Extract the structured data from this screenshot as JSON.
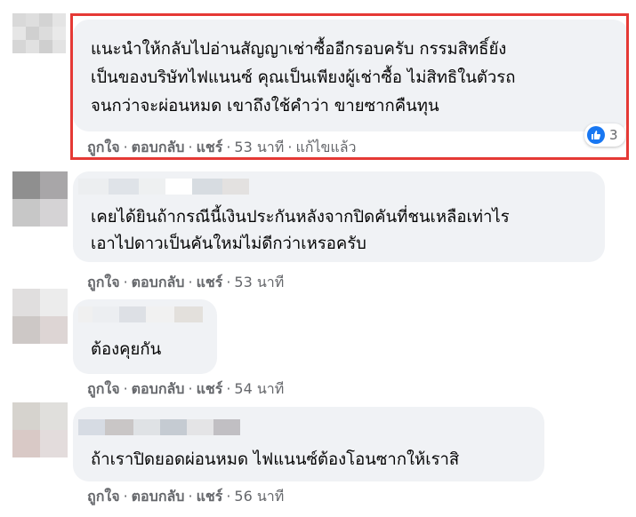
{
  "comments": [
    {
      "text_lines": [
        "แนะนำให้กลับไปอ่านสัญญาเช่าซื้ออีกรอบครับ กรรมสิทธิ์ยัง",
        "เป็นของบริษัทไฟแนนซ์ คุณเป็นเพียงผู้เช่าซื้อ ไม่สิทธิในตัวรถ",
        "จนกว่าจะผ่อนหมด เขาถึงใช้คำว่า ขายซากคืนทุน"
      ],
      "like_label": "ถูกใจ",
      "reply_label": "ตอบกลับ",
      "share_label": "แชร์",
      "time": "53 นาที",
      "edited_label": "แก้ไขแล้ว",
      "reaction_count": "3"
    },
    {
      "text_lines": [
        "เคยได้ยินถ้ากรณีนี้เงินประกันหลังจากปิดคันที่ชนเหลือเท่าไร",
        "เอาไปดาวเป็นคันใหม่ไม่ดีกว่าเหรอครับ"
      ],
      "like_label": "ถูกใจ",
      "reply_label": "ตอบกลับ",
      "share_label": "แชร์",
      "time": "53 นาที"
    },
    {
      "text_lines": [
        "ต้องคุยกัน"
      ],
      "like_label": "ถูกใจ",
      "reply_label": "ตอบกลับ",
      "share_label": "แชร์",
      "time": "54 นาที"
    },
    {
      "text_lines": [
        "ถ้าเราปิดยอดผ่อนหมด ไฟแนนซ์ต้องโอนซากให้เราสิ"
      ],
      "like_label": "ถูกใจ",
      "reply_label": "ตอบกลับ",
      "share_label": "แชร์",
      "time": "56 นาที"
    }
  ],
  "colors": {
    "bubble": "#f0f2f5",
    "meta_text": "#65676b",
    "highlight_border": "#e53935",
    "like_blue": "#1877f2"
  },
  "icons": {
    "reaction": "like-thumbs-up-icon"
  }
}
